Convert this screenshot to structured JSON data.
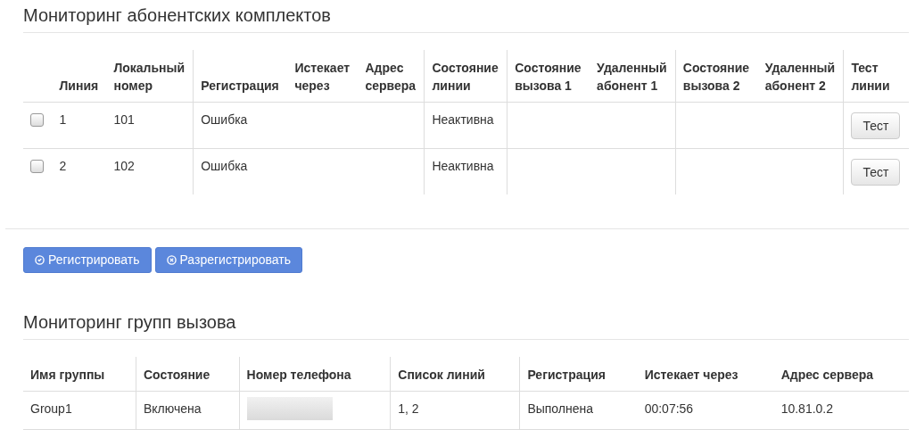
{
  "subscriber_monitoring": {
    "title": "Мониторинг абонентских комплектов",
    "columns": [
      "Линия",
      "Локальный номер",
      "Регистрация",
      "Истекает через",
      "Адрес сервера",
      "Состояние линии",
      "Состояние вызова 1",
      "Удаленный абонент 1",
      "Состояние вызова 2",
      "Удаленный абонент 2",
      "Тест линии"
    ],
    "rows": [
      {
        "checked": false,
        "cells": [
          "1",
          "101",
          "Ошибка",
          "",
          "",
          "Неактивна",
          "",
          "",
          "",
          ""
        ],
        "test_button": "Тест"
      },
      {
        "checked": false,
        "cells": [
          "2",
          "102",
          "Ошибка",
          "",
          "",
          "Неактивна",
          "",
          "",
          "",
          ""
        ],
        "test_button": "Тест"
      }
    ],
    "buttons": [
      {
        "kind": "register",
        "label": "Регистрировать"
      },
      {
        "kind": "unregister",
        "label": "Разрегистрировать"
      }
    ]
  },
  "call_group_monitoring": {
    "title": "Мониторинг групп вызова",
    "columns": [
      "Имя группы",
      "Состояние",
      "Номер телефона",
      "Список линий",
      "Регистрация",
      "Истекает через",
      "Адрес сервера"
    ],
    "rows": [
      {
        "cells": [
          {
            "kind": "text",
            "value": "Group1"
          },
          {
            "kind": "text",
            "value": "Включена"
          },
          {
            "kind": "blurred"
          },
          {
            "kind": "text",
            "value": "1, 2"
          },
          {
            "kind": "text",
            "value": "Выполнена"
          },
          {
            "kind": "text",
            "value": "00:07:56"
          },
          {
            "kind": "text",
            "value": "10.81.0.2"
          }
        ]
      }
    ]
  }
}
